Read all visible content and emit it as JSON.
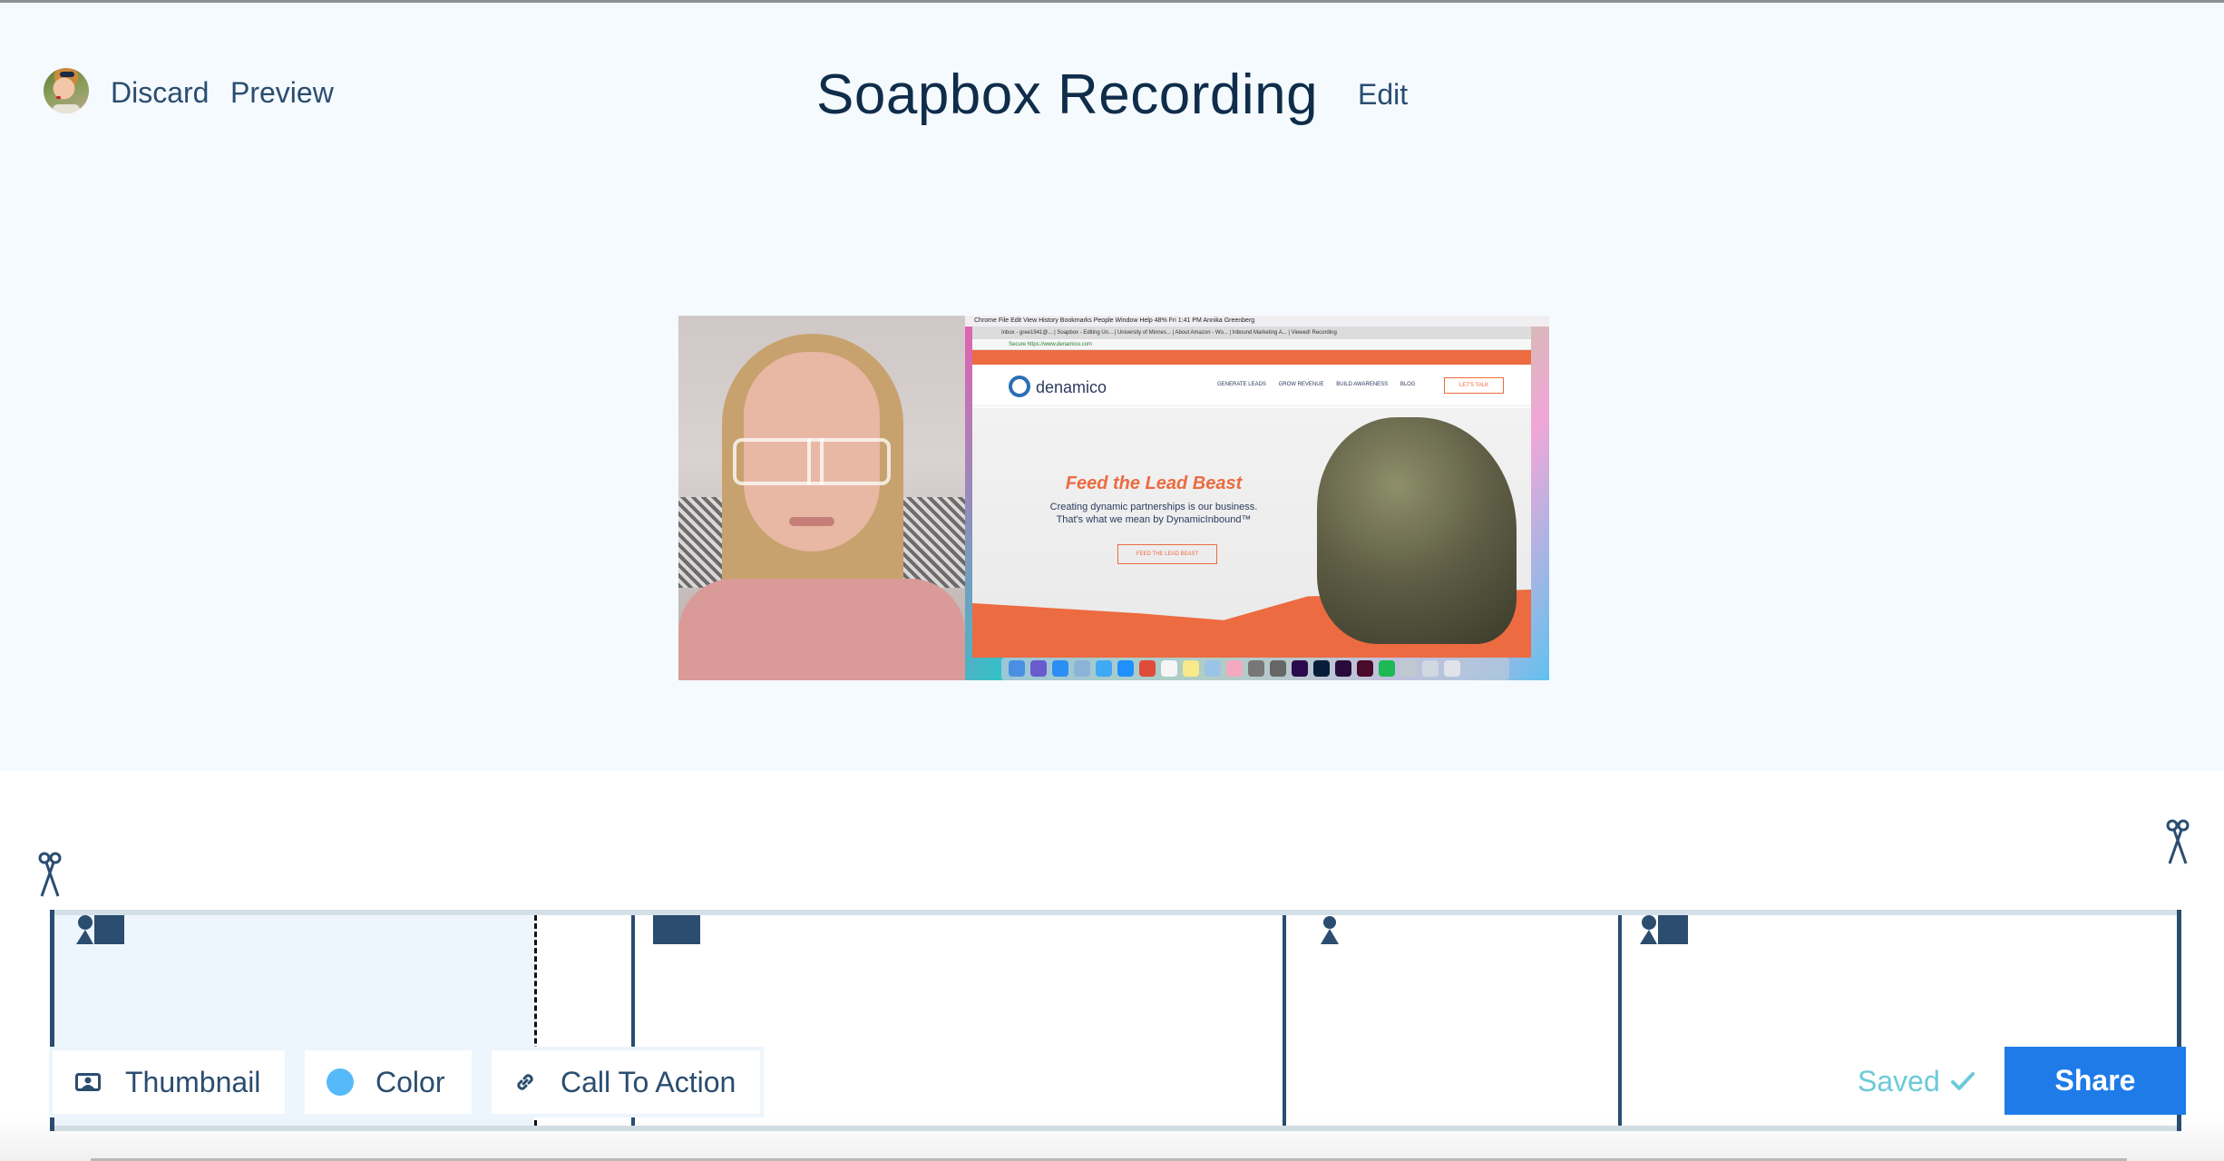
{
  "header": {
    "title": "Soapbox Recording",
    "edit_label": "Edit",
    "discard_label": "Discard",
    "preview_label": "Preview",
    "avatar_alt": "user-avatar"
  },
  "video": {
    "menubar_text": "Chrome  File  Edit  View  History  Bookmarks  People  Window  Help          48%   Fri 1:41 PM   Annika Greenberg",
    "tabs_text": "Inbox - gree1941@...  |  Soapbox - Editing Un...  |  University of Minnes...  |  About Amazon - Wo...  |  Inbound Marketing A...  |  Viewed! Recording",
    "url_text": "Secure  https://www.denamico.com",
    "site_name": "denamico",
    "site_links": [
      "GENERATE LEADS",
      "GROW REVENUE",
      "BUILD AWARENESS",
      "BLOG"
    ],
    "site_cta": "LET'S TALK",
    "hero_title": "Feed the Lead Beast",
    "hero_sub_1": "Creating dynamic partnerships is our business.",
    "hero_sub_2": "That's what we mean by DynamicInbound™",
    "hero_button": "FEED THE LEAD BEAST"
  },
  "timeline": {
    "segments": [
      {
        "type": "camera-and-screen",
        "icon": "person-screen-icon"
      },
      {
        "type": "screen-only",
        "icon": "screen-icon"
      },
      {
        "type": "camera-only",
        "icon": "person-icon"
      },
      {
        "type": "camera-and-screen",
        "icon": "person-screen-icon"
      }
    ]
  },
  "toolbar": {
    "thumbnail_label": "Thumbnail",
    "color_label": "Color",
    "cta_label": "Call To Action",
    "saved_label": "Saved",
    "share_label": "Share"
  },
  "colors": {
    "accent": "#1e7be8",
    "brand_color_swatch": "#56b9fa",
    "saved": "#6ccad9",
    "text": "#2a4d70"
  }
}
